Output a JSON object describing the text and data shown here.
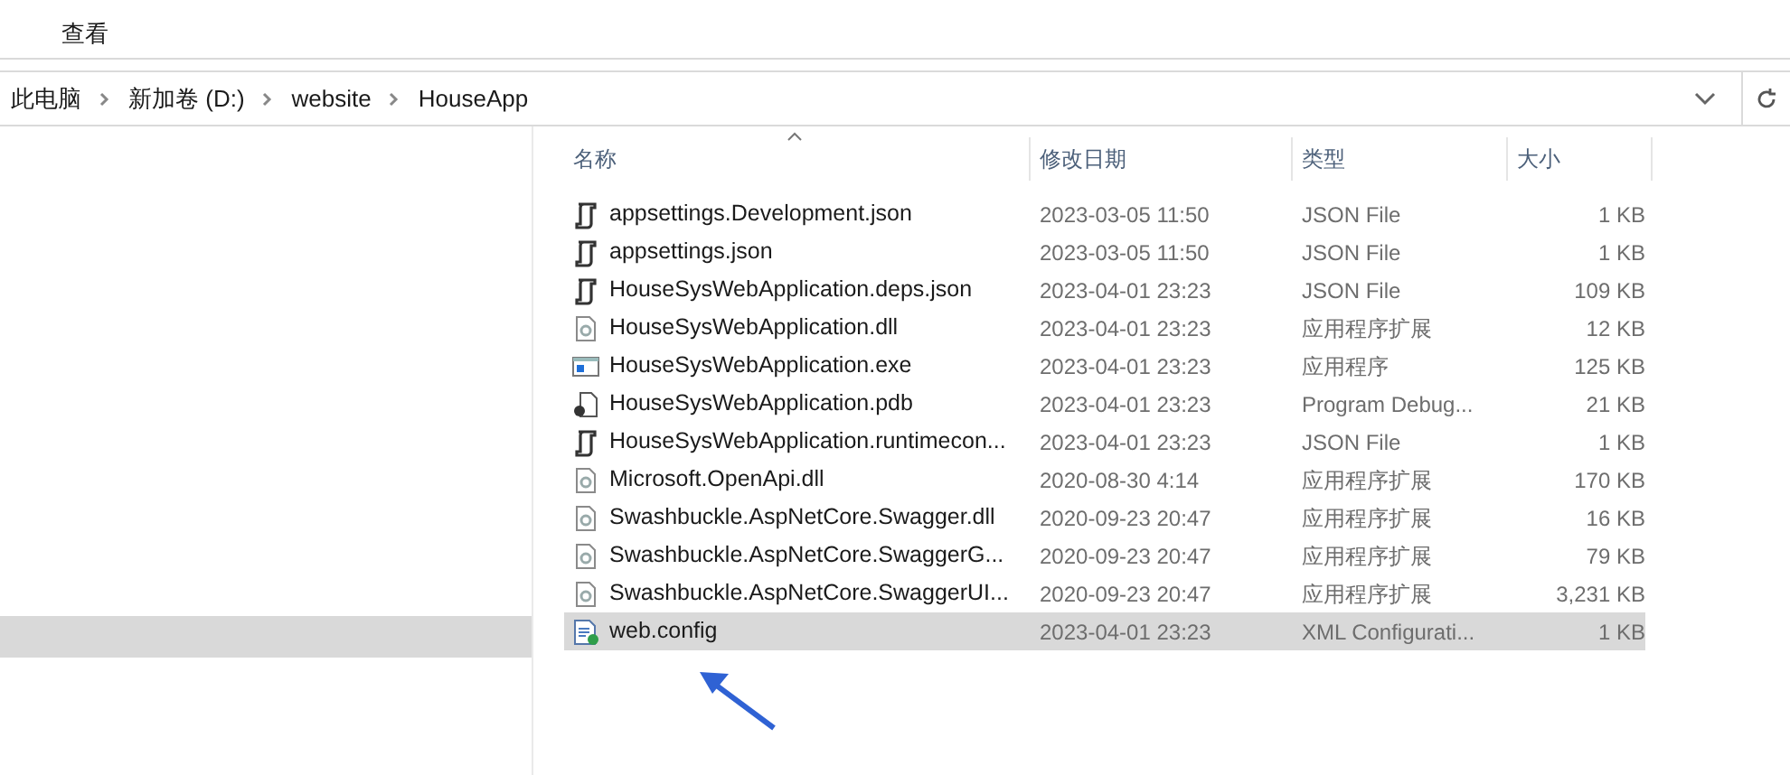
{
  "ribbon_tabs": [
    {
      "label": "查看",
      "selected": false
    }
  ],
  "breadcrumb": [
    "此电脑",
    "新加卷 (D:)",
    "website",
    "HouseApp"
  ],
  "sidebar": {
    "items": [
      {
        "selected": true
      }
    ]
  },
  "table": {
    "columns": [
      "名称",
      "修改日期",
      "类型",
      "大小"
    ],
    "rows": [
      {
        "kind": "json",
        "name": "appsettings.Development.json",
        "date": "2023-03-05 11:50",
        "type": "JSON File",
        "size": "1 KB",
        "selected": false
      },
      {
        "kind": "json",
        "name": "appsettings.json",
        "date": "2023-03-05 11:50",
        "type": "JSON File",
        "size": "1 KB",
        "selected": false
      },
      {
        "kind": "json",
        "name": "HouseSysWebApplication.deps.json",
        "date": "2023-04-01 23:23",
        "type": "JSON File",
        "size": "109 KB",
        "selected": false
      },
      {
        "kind": "dll",
        "name": "HouseSysWebApplication.dll",
        "date": "2023-04-01 23:23",
        "type": "应用程序扩展",
        "size": "12 KB",
        "selected": false
      },
      {
        "kind": "exe",
        "name": "HouseSysWebApplication.exe",
        "date": "2023-04-01 23:23",
        "type": "应用程序",
        "size": "125 KB",
        "selected": false
      },
      {
        "kind": "pdb",
        "name": "HouseSysWebApplication.pdb",
        "date": "2023-04-01 23:23",
        "type": "Program Debug...",
        "size": "21 KB",
        "selected": false
      },
      {
        "kind": "json",
        "name": "HouseSysWebApplication.runtimecon...",
        "date": "2023-04-01 23:23",
        "type": "JSON File",
        "size": "1 KB",
        "selected": false
      },
      {
        "kind": "dll",
        "name": "Microsoft.OpenApi.dll",
        "date": "2020-08-30 4:14",
        "type": "应用程序扩展",
        "size": "170 KB",
        "selected": false
      },
      {
        "kind": "dll",
        "name": "Swashbuckle.AspNetCore.Swagger.dll",
        "date": "2020-09-23 20:47",
        "type": "应用程序扩展",
        "size": "16 KB",
        "selected": false
      },
      {
        "kind": "dll",
        "name": "Swashbuckle.AspNetCore.SwaggerG...",
        "date": "2020-09-23 20:47",
        "type": "应用程序扩展",
        "size": "79 KB",
        "selected": false
      },
      {
        "kind": "dll",
        "name": "Swashbuckle.AspNetCore.SwaggerUI...",
        "date": "2020-09-23 20:47",
        "type": "应用程序扩展",
        "size": "3,231 KB",
        "selected": false
      },
      {
        "kind": "config",
        "name": "web.config",
        "date": "2023-04-01 23:23",
        "type": "XML Configurati...",
        "size": "1 KB",
        "selected": true
      }
    ]
  }
}
